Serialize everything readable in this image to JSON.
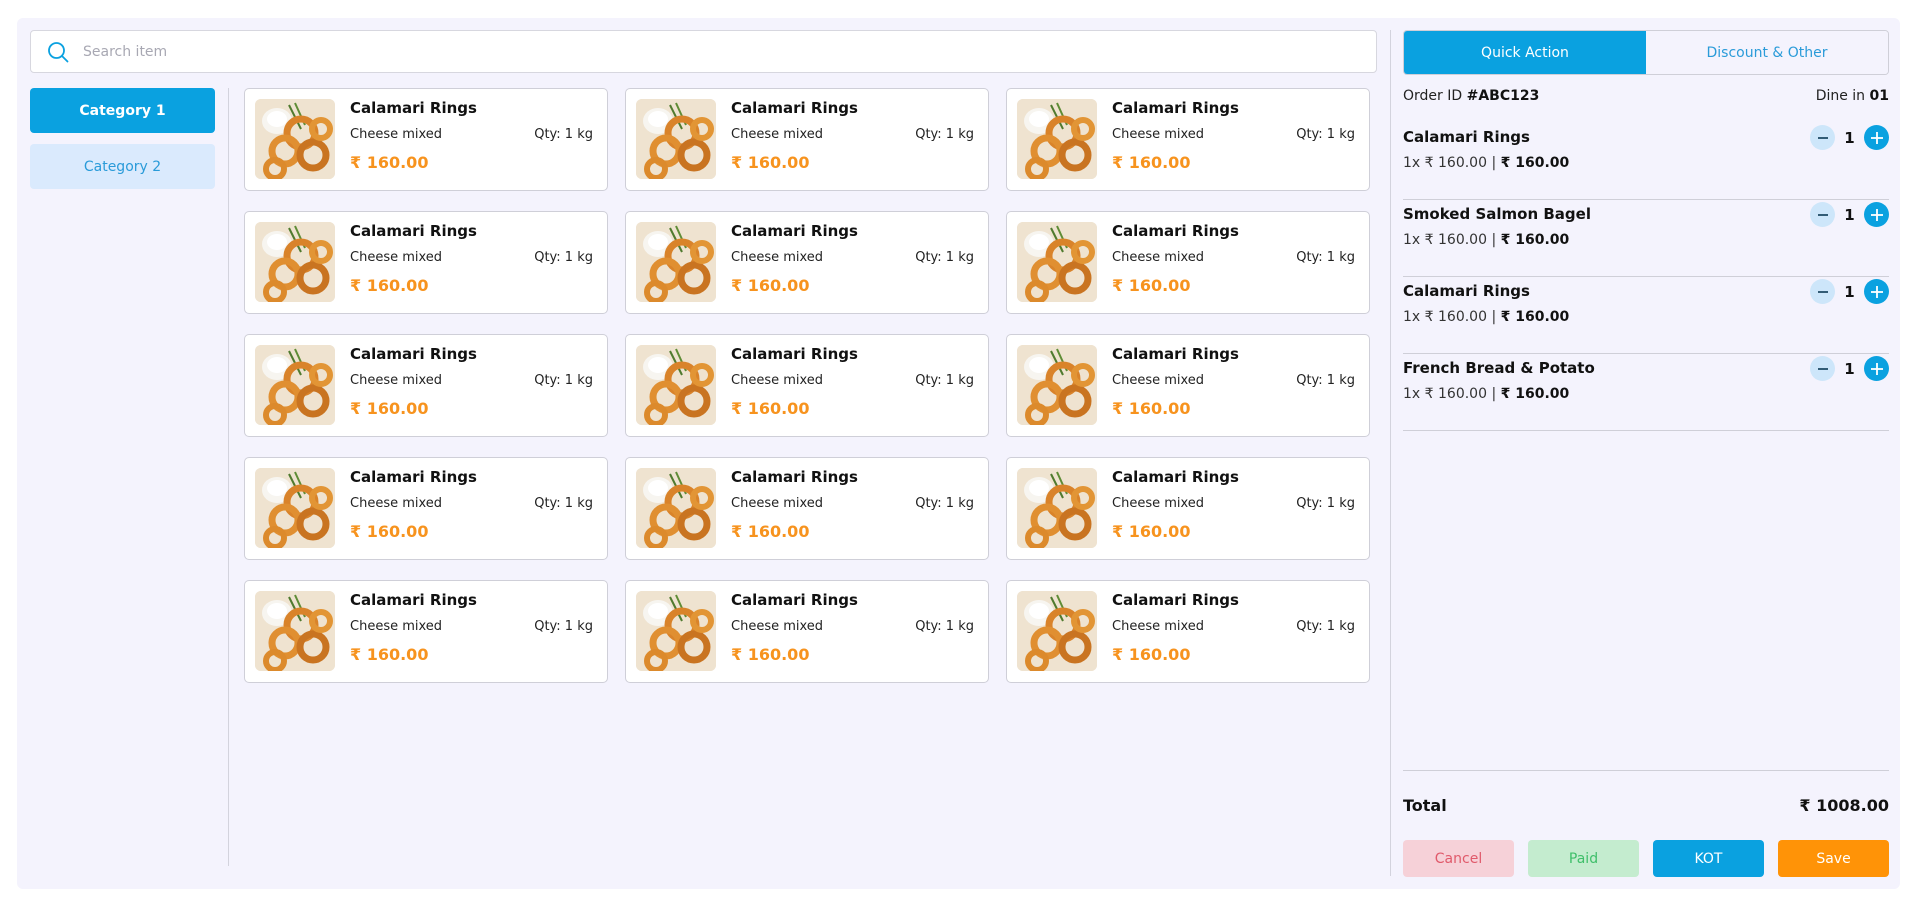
{
  "search": {
    "placeholder": "Search item",
    "value": ""
  },
  "categories": [
    {
      "label": "Category 1",
      "active": true
    },
    {
      "label": "Category 2",
      "active": false
    }
  ],
  "products": [
    {
      "name": "Calamari Rings",
      "desc": "Cheese mixed",
      "qty": "Qty: 1 kg",
      "price": "₹ 160.00"
    },
    {
      "name": "Calamari Rings",
      "desc": "Cheese mixed",
      "qty": "Qty: 1 kg",
      "price": "₹ 160.00"
    },
    {
      "name": "Calamari Rings",
      "desc": "Cheese mixed",
      "qty": "Qty: 1 kg",
      "price": "₹ 160.00"
    },
    {
      "name": "Calamari Rings",
      "desc": "Cheese mixed",
      "qty": "Qty: 1 kg",
      "price": "₹ 160.00"
    },
    {
      "name": "Calamari Rings",
      "desc": "Cheese mixed",
      "qty": "Qty: 1 kg",
      "price": "₹ 160.00"
    },
    {
      "name": "Calamari Rings",
      "desc": "Cheese mixed",
      "qty": "Qty: 1 kg",
      "price": "₹ 160.00"
    },
    {
      "name": "Calamari Rings",
      "desc": "Cheese mixed",
      "qty": "Qty: 1 kg",
      "price": "₹ 160.00"
    },
    {
      "name": "Calamari Rings",
      "desc": "Cheese mixed",
      "qty": "Qty: 1 kg",
      "price": "₹ 160.00"
    },
    {
      "name": "Calamari Rings",
      "desc": "Cheese mixed",
      "qty": "Qty: 1 kg",
      "price": "₹ 160.00"
    },
    {
      "name": "Calamari Rings",
      "desc": "Cheese mixed",
      "qty": "Qty: 1 kg",
      "price": "₹ 160.00"
    },
    {
      "name": "Calamari Rings",
      "desc": "Cheese mixed",
      "qty": "Qty: 1 kg",
      "price": "₹ 160.00"
    },
    {
      "name": "Calamari Rings",
      "desc": "Cheese mixed",
      "qty": "Qty: 1 kg",
      "price": "₹ 160.00"
    },
    {
      "name": "Calamari Rings",
      "desc": "Cheese mixed",
      "qty": "Qty: 1 kg",
      "price": "₹ 160.00"
    },
    {
      "name": "Calamari Rings",
      "desc": "Cheese mixed",
      "qty": "Qty: 1 kg",
      "price": "₹ 160.00"
    },
    {
      "name": "Calamari Rings",
      "desc": "Cheese mixed",
      "qty": "Qty: 1 kg",
      "price": "₹ 160.00"
    }
  ],
  "tabs": [
    {
      "label": "Quick Action",
      "active": true
    },
    {
      "label": "Discount & Other",
      "active": false
    }
  ],
  "order": {
    "id_label": "Order ID",
    "id_value": "#ABC123",
    "dine_label": "Dine in",
    "dine_value": "01",
    "items": [
      {
        "name": "Calamari Rings",
        "qty": "1",
        "unit": "1x ₹ 160.00",
        "sep": "|",
        "amount": "₹ 160.00"
      },
      {
        "name": "Smoked Salmon Bagel",
        "qty": "1",
        "unit": "1x ₹ 160.00",
        "sep": "|",
        "amount": "₹ 160.00"
      },
      {
        "name": "Calamari Rings",
        "qty": "1",
        "unit": "1x ₹ 160.00",
        "sep": "|",
        "amount": "₹ 160.00"
      },
      {
        "name": "French Bread & Potato",
        "qty": "1",
        "unit": "1x ₹ 160.00",
        "sep": "|",
        "amount": "₹ 160.00"
      }
    ],
    "total_label": "Total",
    "total_value": "₹ 1008.00"
  },
  "actions": {
    "cancel": "Cancel",
    "paid": "Paid",
    "kot": "KOT",
    "save": "Save"
  },
  "colors": {
    "accent": "#0aa1e0",
    "price": "#f7931e",
    "save": "#ff9307",
    "cancel_bg": "#f6d1d8",
    "paid_bg": "#c4eccf"
  },
  "icons": {
    "search": "search-icon",
    "minus": "minus-icon",
    "plus": "plus-icon",
    "food": "food-thumbnail"
  }
}
